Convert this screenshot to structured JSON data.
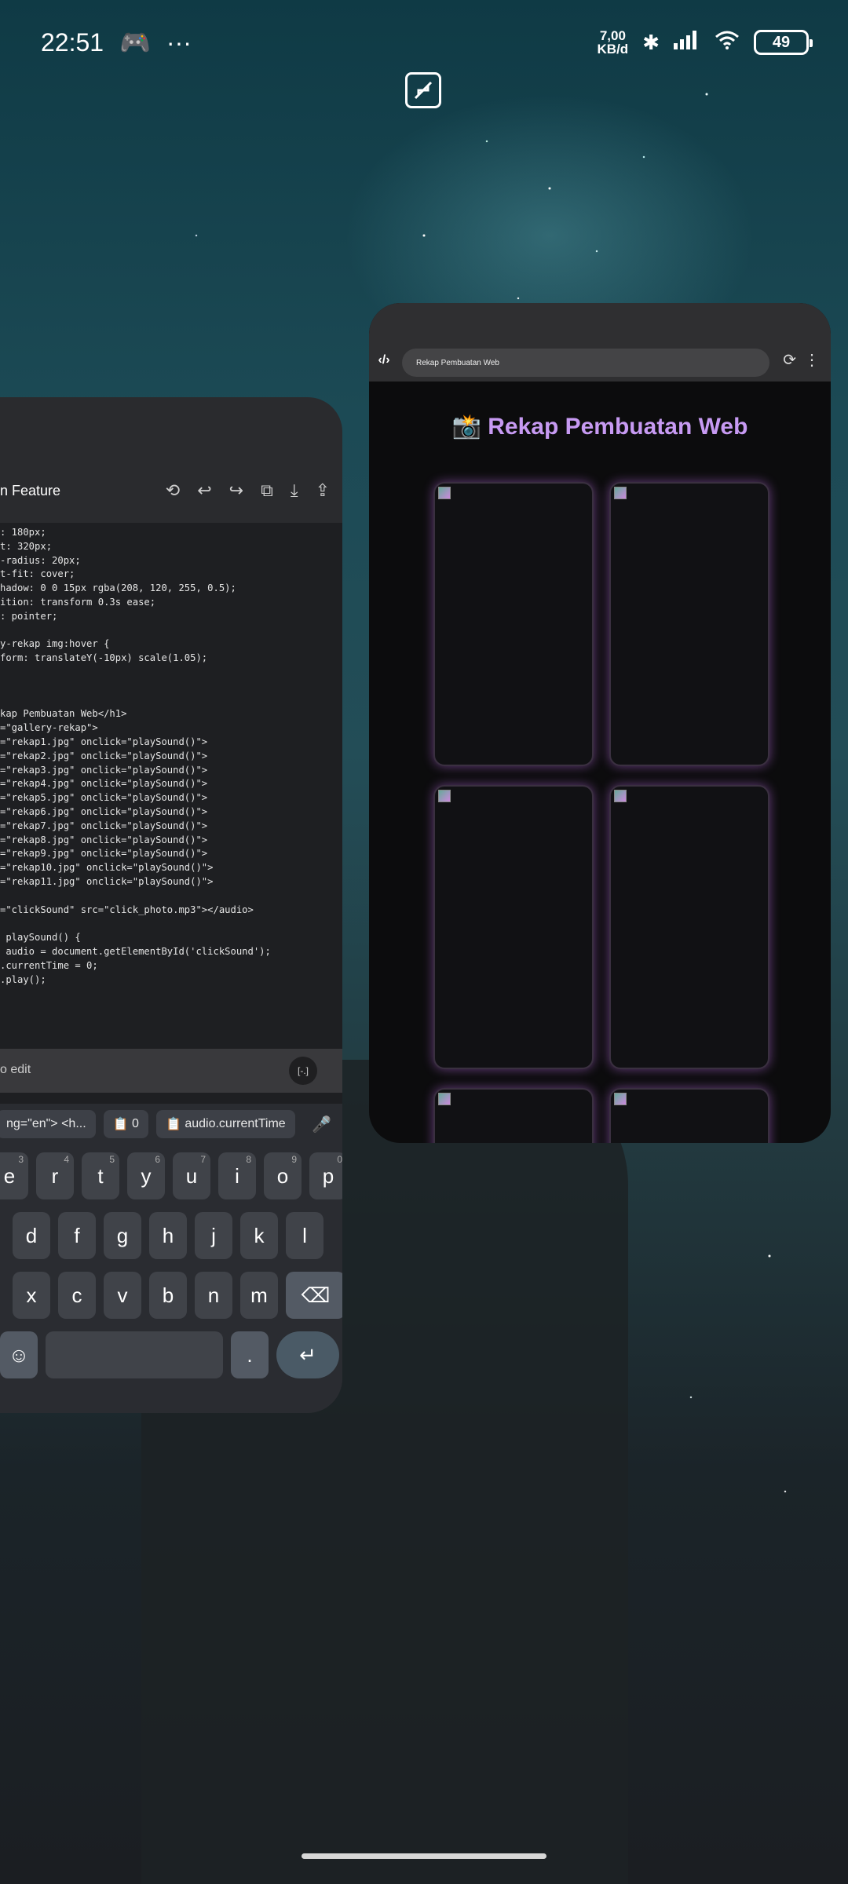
{
  "status_bar": {
    "time": "22:51",
    "notif_more": "···",
    "net_speed_value": "7,00",
    "net_speed_unit": "KB/d",
    "battery": "49"
  },
  "editor": {
    "title": "n Feature",
    "code_lines": [
      ": 180px;",
      "t: 320px;",
      "-radius: 20px;",
      "t-fit: cover;",
      "hadow: 0 0 15px rgba(208, 120, 255, 0.5);",
      "ition: transform 0.3s ease;",
      ": pointer;",
      "",
      "y-rekap img:hover {",
      "form: translateY(-10px) scale(1.05);",
      "",
      "",
      "",
      "kap Pembuatan Web</h1>",
      "=\"gallery-rekap\">",
      "=\"rekap1.jpg\" onclick=\"playSound()\">",
      "=\"rekap2.jpg\" onclick=\"playSound()\">",
      "=\"rekap3.jpg\" onclick=\"playSound()\">",
      "=\"rekap4.jpg\" onclick=\"playSound()\">",
      "=\"rekap5.jpg\" onclick=\"playSound()\">",
      "=\"rekap6.jpg\" onclick=\"playSound()\">",
      "=\"rekap7.jpg\" onclick=\"playSound()\">",
      "=\"rekap8.jpg\" onclick=\"playSound()\">",
      "=\"rekap9.jpg\" onclick=\"playSound()\">",
      "=\"rekap10.jpg\" onclick=\"playSound()\">",
      "=\"rekap11.jpg\" onclick=\"playSound()\">",
      "",
      "=\"clickSound\" src=\"click_photo.mp3\"></audio>",
      "",
      " playSound() {",
      " audio = document.getElementById('clickSound');",
      ".currentTime = 0;",
      ".play();"
    ],
    "input_placeholder": "o edit",
    "input_button": "[-.]"
  },
  "keyboard": {
    "suggestions": [
      "ng=\"en\"> <h...",
      "0",
      "audio.currentTime"
    ],
    "row1": [
      {
        "k": "e",
        "n": "3"
      },
      {
        "k": "r",
        "n": "4"
      },
      {
        "k": "t",
        "n": "5"
      },
      {
        "k": "y",
        "n": "6"
      },
      {
        "k": "u",
        "n": "7"
      },
      {
        "k": "i",
        "n": "8"
      },
      {
        "k": "o",
        "n": "9"
      },
      {
        "k": "p",
        "n": "0"
      }
    ],
    "row2": [
      "d",
      "f",
      "g",
      "h",
      "j",
      "k",
      "l"
    ],
    "row3": [
      "x",
      "c",
      "v",
      "b",
      "n",
      "m"
    ],
    "period": "."
  },
  "browser": {
    "url": "Rekap Pembuatan Web",
    "page_title": "📸 Rekap Pembuatan Web",
    "image_count_visible": 6
  }
}
